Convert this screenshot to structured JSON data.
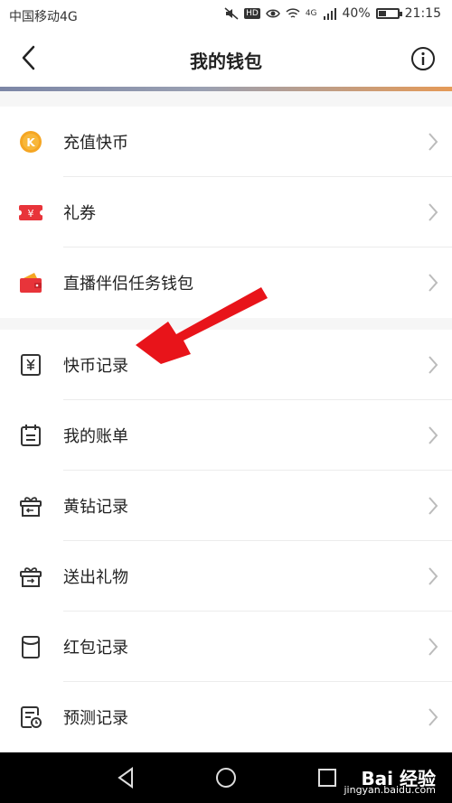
{
  "status_bar": {
    "carrier": "中国移动4G",
    "battery": "40%",
    "time": "21:15",
    "battery_level": 0.4,
    "net": "4G",
    "hd": "HD"
  },
  "header": {
    "title": "我的钱包"
  },
  "section1": {
    "items": [
      {
        "label": "充值快币",
        "icon": "kuaibi-coin-icon"
      },
      {
        "label": "礼券",
        "icon": "coupon-icon"
      },
      {
        "label": "直播伴侣任务钱包",
        "icon": "wallet-icon"
      }
    ]
  },
  "section2": {
    "items": [
      {
        "label": "快币记录",
        "icon": "yuan-record-icon"
      },
      {
        "label": "我的账单",
        "icon": "bill-icon"
      },
      {
        "label": "黄钻记录",
        "icon": "gift-box-in-icon"
      },
      {
        "label": "送出礼物",
        "icon": "gift-box-out-icon"
      },
      {
        "label": "红包记录",
        "icon": "red-packet-icon"
      },
      {
        "label": "预测记录",
        "icon": "forecast-icon"
      }
    ]
  },
  "watermark": {
    "main": "Bai 经验",
    "sub": "jingyan.baidu.com"
  },
  "colors": {
    "arrow": "#e8141a",
    "coin": "#f5a623",
    "coupon": "#e8343a"
  }
}
